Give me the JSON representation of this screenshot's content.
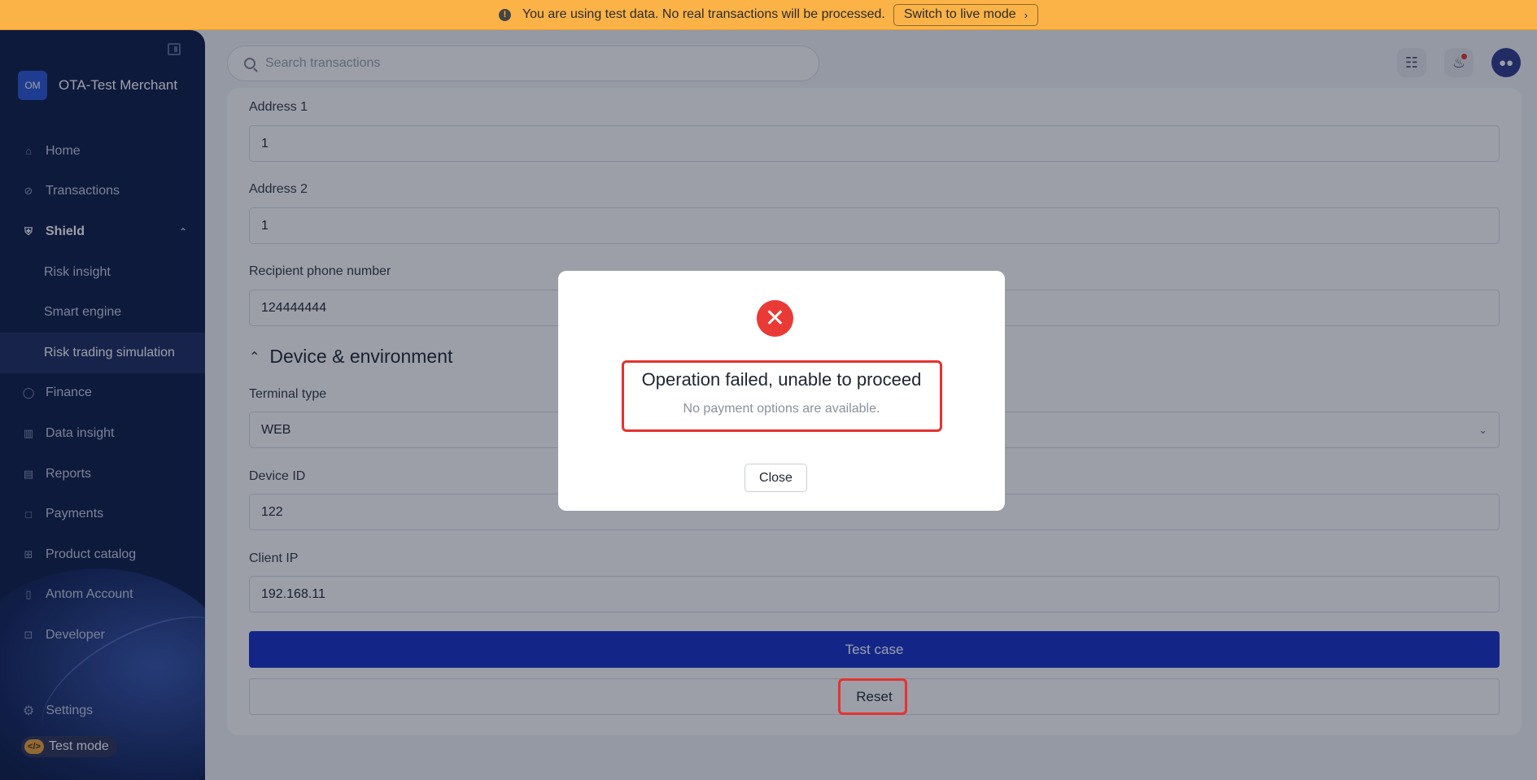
{
  "banner": {
    "message": "You are using test data. No real transactions will be processed.",
    "live_mode_label": "Switch to live mode",
    "color": "#fbb347"
  },
  "sidebar": {
    "merchant_initials": "OM",
    "merchant_name": "OTA-Test Merchant",
    "items": [
      {
        "label": "Home",
        "icon": "home-icon"
      },
      {
        "label": "Transactions",
        "icon": "transactions-icon"
      },
      {
        "label": "Shield",
        "icon": "shield-icon",
        "expanded": true
      },
      {
        "label": "Risk insight"
      },
      {
        "label": "Smart engine"
      },
      {
        "label": "Risk trading simulation",
        "active": true
      },
      {
        "label": "Finance",
        "icon": "finance-icon"
      },
      {
        "label": "Data insight",
        "icon": "chart-icon"
      },
      {
        "label": "Reports",
        "icon": "reports-icon"
      },
      {
        "label": "Payments",
        "icon": "wallet-icon"
      },
      {
        "label": "Product catalog",
        "icon": "grid-icon"
      },
      {
        "label": "Antom Account",
        "icon": "account-icon"
      },
      {
        "label": "Developer",
        "icon": "terminal-icon"
      }
    ],
    "settings_label": "Settings",
    "test_mode_label": "Test mode"
  },
  "header": {
    "search_placeholder": "Search transactions"
  },
  "form": {
    "address1_label": "Address 1",
    "address1_value": "1",
    "address2_label": "Address 2",
    "address2_value": "1",
    "phone_label": "Recipient phone number",
    "phone_value": "124444444",
    "section_title": "Device & environment",
    "terminal_label": "Terminal type",
    "terminal_value": "WEB",
    "device_label": "Device ID",
    "device_value": "122",
    "ip_label": "Client IP",
    "ip_value": "192.168.11",
    "test_case_label": "Test case",
    "reset_label": "Reset"
  },
  "modal": {
    "title": "Operation failed, unable to proceed",
    "description": "No payment options are available.",
    "close_label": "Close",
    "error_color": "#ea3a36"
  }
}
